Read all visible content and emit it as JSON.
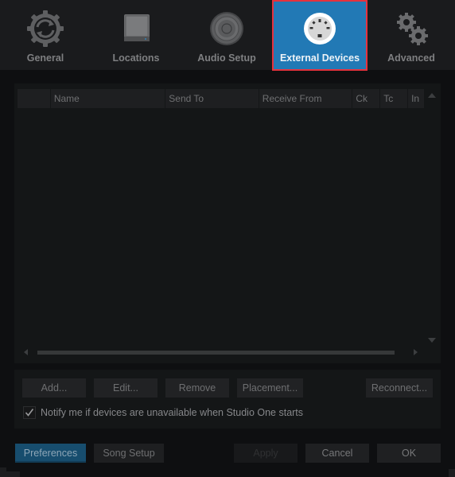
{
  "tabs": [
    {
      "id": "general",
      "label": "General",
      "icon": "gear-sync-icon",
      "active": false
    },
    {
      "id": "locations",
      "label": "Locations",
      "icon": "drive-icon",
      "active": false
    },
    {
      "id": "audio_setup",
      "label": "Audio Setup",
      "icon": "speaker-icon",
      "active": false
    },
    {
      "id": "external_devices",
      "label": "External Devices",
      "icon": "midi-connector-icon",
      "active": true
    },
    {
      "id": "advanced",
      "label": "Advanced",
      "icon": "gears-icon",
      "active": false
    }
  ],
  "device_table": {
    "columns": [
      "",
      "Name",
      "Send To",
      "Receive From",
      "Ck",
      "Tc",
      "In"
    ],
    "rows": []
  },
  "actions": {
    "add": "Add...",
    "edit": "Edit...",
    "remove": "Remove",
    "placement": "Placement...",
    "reconnect": "Reconnect..."
  },
  "notify_option": {
    "label": "Notify me if devices are unavailable when Studio One starts",
    "checked": true
  },
  "footer": {
    "preferences": "Preferences",
    "song_setup": "Song Setup",
    "apply": "Apply",
    "cancel": "Cancel",
    "ok": "OK"
  },
  "colors": {
    "accent": "#2279b5",
    "active_outline": "#e5323e",
    "preferences_tab": "#174d6e"
  }
}
